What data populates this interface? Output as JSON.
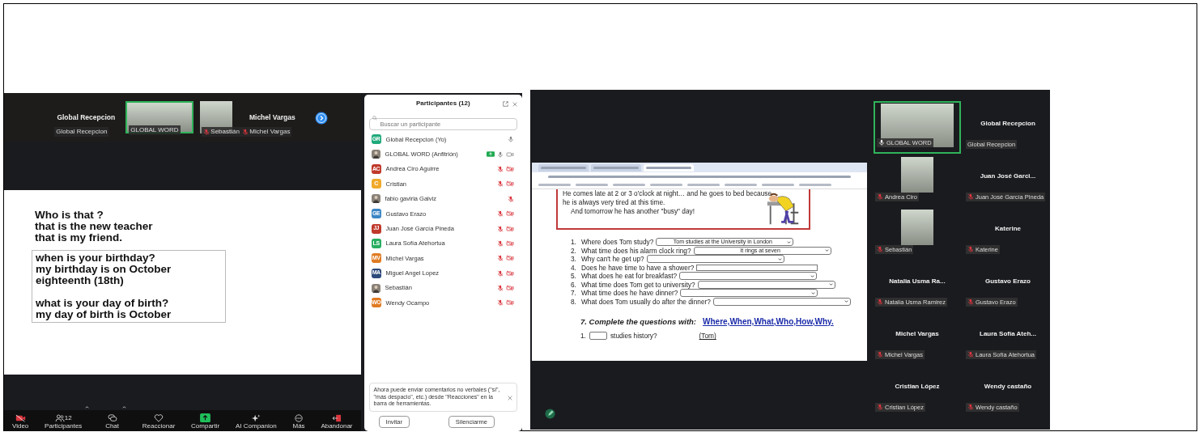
{
  "left_meeting": {
    "strip": [
      {
        "kind": "name",
        "name": "Global Recepcion",
        "label": "Global Recepcion",
        "speaking": false
      },
      {
        "kind": "video",
        "label": "GLOBAL WORD",
        "speaking": true
      },
      {
        "kind": "video",
        "label": "Sebastián",
        "muted": true,
        "speaking": false
      },
      {
        "kind": "name",
        "name": "Michel Vargas",
        "label": "Michel Vargas",
        "muted": true,
        "speaking": false
      }
    ],
    "slide": {
      "text_boxes": [
        {
          "selected": false,
          "paragraphs": [
            [
              "Who is that ?",
              "that is the new teacher",
              "that is my friend."
            ]
          ]
        },
        {
          "selected": true,
          "paragraphs": [
            [
              "when is your birthday?",
              "my birthday is on October",
              "eighteenth (18th)"
            ],
            [
              "what is your day of birth?",
              "my day of birth is October"
            ]
          ]
        }
      ]
    },
    "toolbar": [
      {
        "kind": "video_off",
        "label": "Video"
      },
      {
        "kind": "participants",
        "label": "Participantes",
        "count": "12",
        "caret": true
      },
      {
        "kind": "chat",
        "label": "Chat",
        "caret": true
      },
      {
        "kind": "react",
        "label": "Reaccionar"
      },
      {
        "kind": "share",
        "label": "Compartir"
      },
      {
        "kind": "ai",
        "label": "AI Companion"
      },
      {
        "kind": "more",
        "label": "Más"
      },
      {
        "kind": "leave",
        "label": "Abandonar"
      }
    ],
    "participants_panel": {
      "title": "Participantes (12)",
      "search": {
        "placeholder": "Buscar un participante"
      },
      "items": [
        {
          "kind": "initials",
          "initials": "GR",
          "color": "#1fa97a",
          "name": "Global Recepcion (Yo)",
          "muted": false
        },
        {
          "kind": "photo",
          "name": "GLOBAL WORD (Anfitrión)",
          "sharing": true,
          "muted": false,
          "video_off": false
        },
        {
          "kind": "initials",
          "initials": "AC",
          "color": "#c0392b",
          "name": "Andrea Ciro Aguirre",
          "muted": true,
          "video_off": true
        },
        {
          "kind": "initials",
          "initials": "C",
          "color": "#f0a92b",
          "name": "Cristian",
          "muted": true,
          "video_off": true
        },
        {
          "kind": "photo",
          "name": "fabio gaviria Galviz",
          "muted": true
        },
        {
          "kind": "initials",
          "initials": "GE",
          "color": "#3a85c4",
          "name": "Gustavo Erazo",
          "muted": true,
          "video_off": true
        },
        {
          "kind": "initials",
          "initials": "JJ",
          "color": "#c0392b",
          "name": "Juan José García Pineda",
          "muted": true,
          "video_off": true
        },
        {
          "kind": "initials",
          "initials": "LS",
          "color": "#27ae60",
          "name": "Laura Sofía Atehortua",
          "muted": true,
          "video_off": true
        },
        {
          "kind": "initials",
          "initials": "MV",
          "color": "#e07b22",
          "name": "Michel Vargas",
          "muted": true,
          "video_off": true
        },
        {
          "kind": "initials",
          "initials": "MA",
          "color": "#2c4a7a",
          "name": "Miguel Angel Lopez",
          "muted": true,
          "video_off": true
        },
        {
          "kind": "photo",
          "name": "Sebastián",
          "muted": true,
          "video_off": true
        },
        {
          "kind": "initials",
          "initials": "WO",
          "color": "#e07b22",
          "name": "Wendy Ocampo",
          "muted": true,
          "video_off": true
        }
      ],
      "notice": "Ahora puede enviar comentarios no verbales (\"sí\", \"más despacio\", etc.) desde \"Reacciones\" en la barra de herramientas.",
      "buttons": [
        "Invitar",
        "Silenciarme"
      ]
    }
  },
  "right_meeting": {
    "browser": {
      "tabs": [
        {
          "selected": false
        },
        {
          "selected": false
        },
        {
          "selected": true
        }
      ],
      "story": [
        "He comes late at 2 or 3 o'clock at night… and he goes to bed because",
        "he is always very tired at this time.",
        "And tomorrow he has another \"busy\" day!"
      ],
      "questions": [
        {
          "number": "1.",
          "text": "Where does Tom study?",
          "kind": "select",
          "answer": "Tom studies at the University in London"
        },
        {
          "number": "2.",
          "text": "What time does his alarm clock ring?",
          "kind": "select",
          "answer": "It rings at seven"
        },
        {
          "number": "3.",
          "text": "Why can't he get up?",
          "kind": "select"
        },
        {
          "number": "4.",
          "text": "Does he have time to have a shower?",
          "kind": "text"
        },
        {
          "number": "5.",
          "text": "What does he eat for breakfast?",
          "kind": "select"
        },
        {
          "number": "6.",
          "text": "What time does Tom get to university?",
          "kind": "select"
        },
        {
          "number": "7.",
          "text": "What time does he have dinner?",
          "kind": "select"
        },
        {
          "number": "8.",
          "text": "What does Tom usually do after the dinner?",
          "kind": "select"
        }
      ],
      "exercise": {
        "heading": "7. Complete the questions with:",
        "words": [
          "Where,",
          "When,",
          "What,",
          "Who,",
          "How,",
          "Why."
        ],
        "first_item": {
          "number": "1.",
          "text": "studies history?",
          "hint": "(Tom)"
        }
      }
    },
    "gallery": [
      {
        "kind": "video",
        "label": "GLOBAL WORD",
        "muted": false,
        "speaking": true
      },
      {
        "kind": "name",
        "name": "Global Recepcion",
        "label": "Global Recepcion",
        "speaking": false
      },
      {
        "kind": "video",
        "label": "Andrea Ciro",
        "muted": true,
        "speaking": false
      },
      {
        "kind": "name",
        "name": "Juan José Garci...",
        "label": "Juan José García Pineda",
        "muted": true,
        "speaking": false
      },
      {
        "kind": "video",
        "label": "Sebastián",
        "muted": true,
        "speaking": false
      },
      {
        "kind": "name",
        "name": "Katerine",
        "label": "Katerine",
        "muted": true,
        "speaking": false
      },
      {
        "kind": "name",
        "name": "Natalia Usma Ra...",
        "label": "Natalia Usma Ramirez",
        "muted": true,
        "speaking": false
      },
      {
        "kind": "name",
        "name": "Gustavo Erazo",
        "label": "Gustavo Erazo",
        "muted": true,
        "speaking": false
      },
      {
        "kind": "name",
        "name": "Michel Vargas",
        "label": "Michel Vargas",
        "muted": true,
        "speaking": false
      },
      {
        "kind": "name",
        "name": "Laura Sofía Ateh...",
        "label": "Laura Sofía Atehortua",
        "muted": true,
        "speaking": false
      },
      {
        "kind": "name",
        "name": "Cristian López",
        "label": "Cristian López",
        "muted": true,
        "speaking": false
      },
      {
        "kind": "name",
        "name": "Wendy castaño",
        "label": "Wendy castaño",
        "muted": true,
        "speaking": false
      }
    ]
  }
}
